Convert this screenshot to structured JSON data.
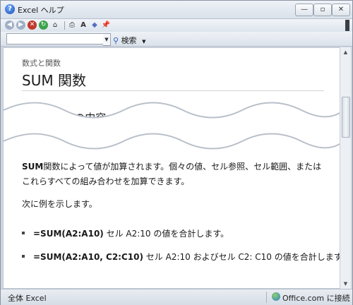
{
  "window": {
    "title": "Excel ヘルプ"
  },
  "toolbar": {
    "icons": [
      "back-icon",
      "forward-icon",
      "stop-icon",
      "refresh-icon",
      "home-icon",
      "print-icon",
      "font-size-icon",
      "book-icon",
      "pin-icon"
    ]
  },
  "search": {
    "value": "",
    "button_label": "検索"
  },
  "content": {
    "breadcrumb": "数式と関数",
    "title": "SUM 関数",
    "section_heading": "このコースの内容:",
    "para1_bold": "SUM",
    "para1_rest": "関数によって値が加算されます。個々の値、セル参照、セル範囲、またはこれらすべての組み合わせを加算できます。",
    "para2": "次に例を示します。",
    "bullets": [
      {
        "formula": "=SUM(A2:A10)",
        "desc": " セル A2:10 の値を合計します。"
      },
      {
        "formula": "=SUM(A2:A10, C2:C10)",
        "desc": " セル A2:10 およびセル C2: C10 の値を合計します。"
      }
    ]
  },
  "status": {
    "left": "全体 Excel",
    "right": "Office.com に接続"
  }
}
